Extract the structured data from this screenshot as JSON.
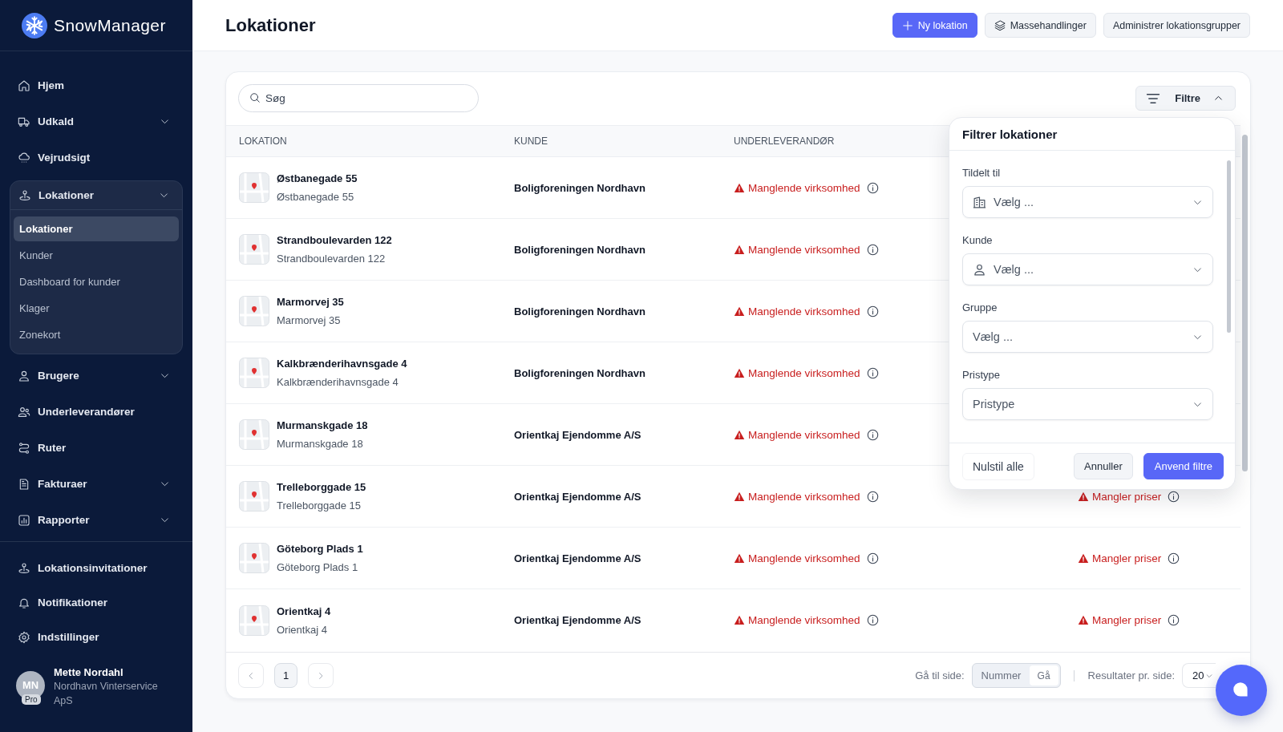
{
  "sidebar": {
    "brand": "SnowManager",
    "nav": [
      {
        "label": "Hjem"
      },
      {
        "label": "Udkald",
        "expanded": false
      },
      {
        "label": "Vejrudsigt"
      },
      {
        "label": "Lokationer",
        "expanded": true,
        "children": [
          {
            "label": "Lokationer",
            "selected": true
          },
          {
            "label": "Kunder",
            "selected": false
          },
          {
            "label": "Dashboard for kunder",
            "selected": false
          },
          {
            "label": "Klager",
            "selected": false
          },
          {
            "label": "Zonekort",
            "selected": false
          }
        ]
      },
      {
        "label": "Brugere",
        "expanded": false
      },
      {
        "label": "Underleverandører"
      },
      {
        "label": "Ruter"
      },
      {
        "label": "Fakturaer",
        "expanded": false
      },
      {
        "label": "Rapporter",
        "expanded": false
      }
    ],
    "nav_bottom": [
      {
        "label": "Lokationsinvitationer"
      },
      {
        "label": "Notifikationer"
      },
      {
        "label": "Indstillinger"
      }
    ],
    "user": {
      "initials": "MN",
      "badge": "Pro",
      "name": "Mette Nordahl",
      "company": "Nordhavn Vinterservice ApS"
    }
  },
  "header": {
    "title": "Lokationer",
    "actions": [
      {
        "label": "Ny lokation",
        "kind": "primary"
      },
      {
        "label": "Massehandlinger",
        "kind": "secondary"
      },
      {
        "label": "Administrer lokationsgrupper",
        "kind": "secondary"
      }
    ]
  },
  "toolbar": {
    "search": {
      "placeholder": "Søg"
    },
    "filter_button": {
      "label": "Filtre",
      "expanded": true
    }
  },
  "table": {
    "columns": [
      "LOKATION",
      "KUNDE",
      "UNDERLEVERANDØR"
    ],
    "rows": [
      {
        "name": "Østbanegade 55",
        "address": "Østbanegade 55",
        "customer": "Boligforeningen Nordhavn",
        "subcontractor": "Manglende virksomhed"
      },
      {
        "name": "Strandboulevarden 122",
        "address": "Strandboulevarden 122",
        "customer": "Boligforeningen Nordhavn",
        "subcontractor": "Manglende virksomhed"
      },
      {
        "name": "Marmorvej 35",
        "address": "Marmorvej 35",
        "customer": "Boligforeningen Nordhavn",
        "subcontractor": "Manglende virksomhed"
      },
      {
        "name": "Kalkbrænderihavnsgade 4",
        "address": "Kalkbrænderihavnsgade 4",
        "customer": "Boligforeningen Nordhavn",
        "subcontractor": "Manglende virksomhed"
      },
      {
        "name": "Murmanskgade 18",
        "address": "Murmanskgade 18",
        "customer": "Orientkaj Ejendomme A/S",
        "subcontractor": "Manglende virksomhed"
      },
      {
        "name": "Trelleborggade 15",
        "address": "Trelleborggade 15",
        "customer": "Orientkaj Ejendomme A/S",
        "subcontractor": "Manglende virksomhed",
        "column_4": "Mangler priser"
      },
      {
        "name": "Göteborg Plads 1",
        "address": "Göteborg Plads 1",
        "customer": "Orientkaj Ejendomme A/S",
        "subcontractor": "Manglende virksomhed",
        "column_4": "Mangler priser"
      },
      {
        "name": "Orientkaj 4",
        "address": "Orientkaj 4",
        "customer": "Orientkaj Ejendomme A/S",
        "subcontractor": "Manglende virksomhed",
        "column_4": "Mangler priser"
      }
    ]
  },
  "filter_panel": {
    "title": "Filtrer lokationer",
    "fields": [
      {
        "label": "Tildelt til",
        "placeholder": "Vælg ..."
      },
      {
        "label": "Kunde",
        "placeholder": "Vælg ..."
      },
      {
        "label": "Gruppe",
        "placeholder": "Vælg ..."
      },
      {
        "label": "Pristype",
        "placeholder": "Pristype"
      }
    ],
    "buttons": [
      {
        "label": "Nulstil alle",
        "kind": "ghost"
      },
      {
        "label": "Annuller",
        "kind": "secondary"
      },
      {
        "label": "Anvend filtre",
        "kind": "primary"
      }
    ]
  },
  "pagination": {
    "pages": [
      {
        "label": "1",
        "selected": true
      }
    ],
    "goto_label": "Gå til side:",
    "goto_placeholder": "Nummer",
    "goto_button": "Gå",
    "per_page_label": "Resultater pr. side:",
    "per_page_value": "20"
  }
}
